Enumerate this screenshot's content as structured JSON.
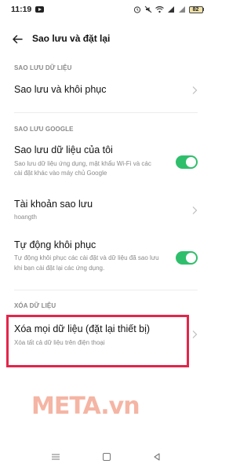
{
  "status_bar": {
    "time": "11:19",
    "battery": "82"
  },
  "header": {
    "title": "Sao lưu và đặt lại"
  },
  "sections": {
    "backup_restore": {
      "label": "SAO LƯU DỮ LIỆU",
      "item_title": "Sao lưu và khôi phục"
    },
    "google_backup": {
      "label": "SAO LƯU GOOGLE",
      "backup_data_title": "Sao lưu dữ liệu của tôi",
      "backup_data_sub_1": "Sao lưu dữ liệu ứng dụng, mật khẩu Wi-Fi và các",
      "backup_data_sub_2": "cài đặt khác vào máy chủ Google",
      "backup_data_enabled": true,
      "account_title": "Tài khoản sao lưu",
      "account_value": "hoangth",
      "auto_restore_title": "Tự động khôi phục",
      "auto_restore_sub_1": "Tự động khôi phục các cài đặt và dữ liệu đã sao lưu",
      "auto_restore_sub_2": "khi bạn cài đặt lại các ứng dụng.",
      "auto_restore_enabled": true
    },
    "erase": {
      "label": "XÓA DỮ LIỆU",
      "item_title": "Xóa mọi dữ liệu (đặt lại thiết bị)",
      "item_sub": "Xóa tất cả dữ liệu trên điện thoại"
    }
  },
  "watermark": "META.vn",
  "colors": {
    "toggle_on": "#2fbf6c",
    "highlight": "#e4254a",
    "watermark": "#f5b5a4",
    "secondary_text": "#8a8a8a"
  }
}
